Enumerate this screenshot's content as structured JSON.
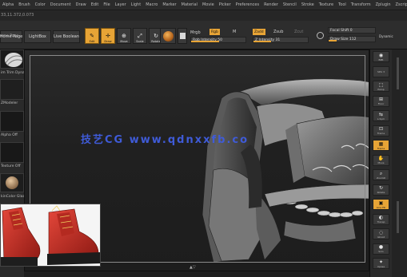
{
  "menu": [
    "Alpha",
    "Brush",
    "Color",
    "Document",
    "Draw",
    "Edit",
    "File",
    "Layer",
    "Light",
    "Macro",
    "Marker",
    "Material",
    "Movie",
    "Picker",
    "Preferences",
    "Render",
    "Stencil",
    "Stroke",
    "Texture",
    "Tool",
    "Transform",
    "Zplugin",
    "Zscript"
  ],
  "status": {
    "coords": "33,11.372,0.073"
  },
  "shelf": {
    "home_page": "Home Page",
    "lightbox": "LightBox",
    "live_boolean": "Live Boolean",
    "tools": [
      {
        "label": "Edit",
        "icon": "✎",
        "active": true
      },
      {
        "label": "Draw",
        "icon": "✛",
        "active": true
      },
      {
        "label": "Move",
        "icon": "⊕",
        "active": false
      },
      {
        "label": "Scale",
        "icon": "⤢",
        "active": false
      },
      {
        "label": "Rotate",
        "icon": "↻",
        "active": false
      }
    ],
    "mrgb": "Mrgb",
    "rgb": "Rgb",
    "m": "M",
    "rgb_intensity": "Rgb Intensity 50",
    "zadd": "Zadd",
    "zsub": "Zsub",
    "zcut": "Zcut",
    "z_intensity": "Z Intensity 31",
    "focal_shift": "Focal Shift 0",
    "draw_size": "Draw Size 112",
    "dynamic": "Dynamic"
  },
  "left_panel": {
    "home_page": "ome Page",
    "trim_label": "im Trim Dynamic",
    "brush_label": "ZModeler",
    "alpha_off": "Alpha Off",
    "texture_off": "Texture Off",
    "skincolor": "kinColor Glaz"
  },
  "viewport": {
    "watermark": "技艺CG  www.qdnxxfb.co",
    "bottom_marker": "▲▽"
  },
  "right_panel": [
    {
      "label": "BPR",
      "icon": "◉",
      "active": false
    },
    {
      "label": "SPix 3",
      "icon": "",
      "active": false
    },
    {
      "label": "Persp",
      "icon": "⬚",
      "active": false
    },
    {
      "label": "Floor",
      "icon": "⊞",
      "active": false
    },
    {
      "label": "L.Sym",
      "icon": "⇆",
      "active": false
    },
    {
      "label": "Frame",
      "icon": "⊡",
      "active": false
    },
    {
      "label": "Frame",
      "icon": "▦",
      "active": true
    },
    {
      "label": "Move",
      "icon": "✋",
      "active": false
    },
    {
      "label": "ZoomD",
      "icon": "⌕",
      "active": false
    },
    {
      "label": "Rotate",
      "icon": "↻",
      "active": false
    },
    {
      "label": "Line Fill",
      "icon": "▣",
      "active": true
    },
    {
      "label": "Transp",
      "icon": "◐",
      "active": false
    },
    {
      "label": "Ghost",
      "icon": "◌",
      "active": false
    },
    {
      "label": "Solo",
      "icon": "●",
      "active": false
    },
    {
      "label": "Xpose",
      "icon": "✦",
      "active": false
    }
  ],
  "colors": {
    "accent": "#e7a436",
    "watermark": "#3f5bd8",
    "panel": "#2a2a2a"
  }
}
